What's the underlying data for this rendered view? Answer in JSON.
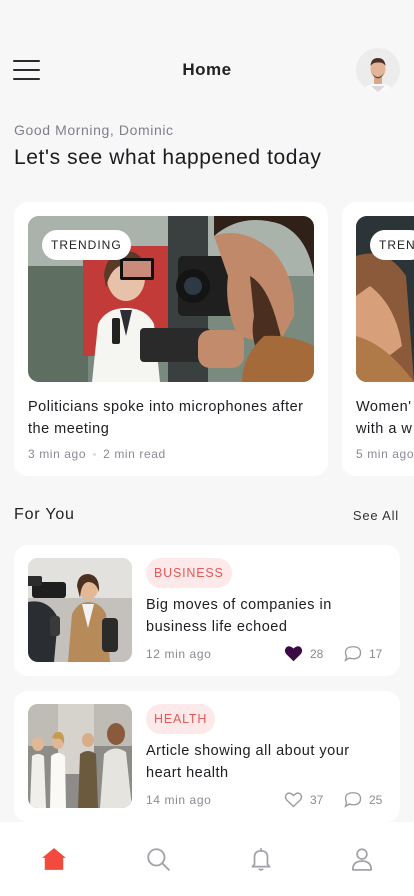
{
  "header": {
    "title": "Home",
    "menu_icon": "hamburger-menu-icon",
    "avatar_icon": "user-avatar"
  },
  "greeting": "Good Morning, Dominic",
  "headline": "Let's see what happened today",
  "trending": [
    {
      "badge": "TRENDING",
      "title": "Politicians spoke into microphones after the meeting",
      "time": "3 min ago",
      "read": "2 min read"
    },
    {
      "badge": "TREN",
      "title": "Women'\nwith a w",
      "time": "5 min ago"
    }
  ],
  "for_you": {
    "title": "For You",
    "see_all": "See All",
    "items": [
      {
        "category": "BUSINESS",
        "title": "Big moves of companies in business life echoed",
        "time": "12 min ago",
        "likes": "28",
        "comments": "17",
        "liked": true
      },
      {
        "category": "HEALTH",
        "title": "Article showing all about your heart health",
        "time": "14 min ago",
        "likes": "37",
        "comments": "25",
        "liked": false
      }
    ]
  },
  "tabbar": {
    "items": [
      "home-icon",
      "search-icon",
      "bell-icon",
      "profile-icon"
    ],
    "active": "home",
    "accent": "#f24a3d"
  },
  "colors": {
    "badge_bg": "#fde9e9",
    "badge_text": "#e05a5a",
    "heart": "#3b0a45"
  }
}
